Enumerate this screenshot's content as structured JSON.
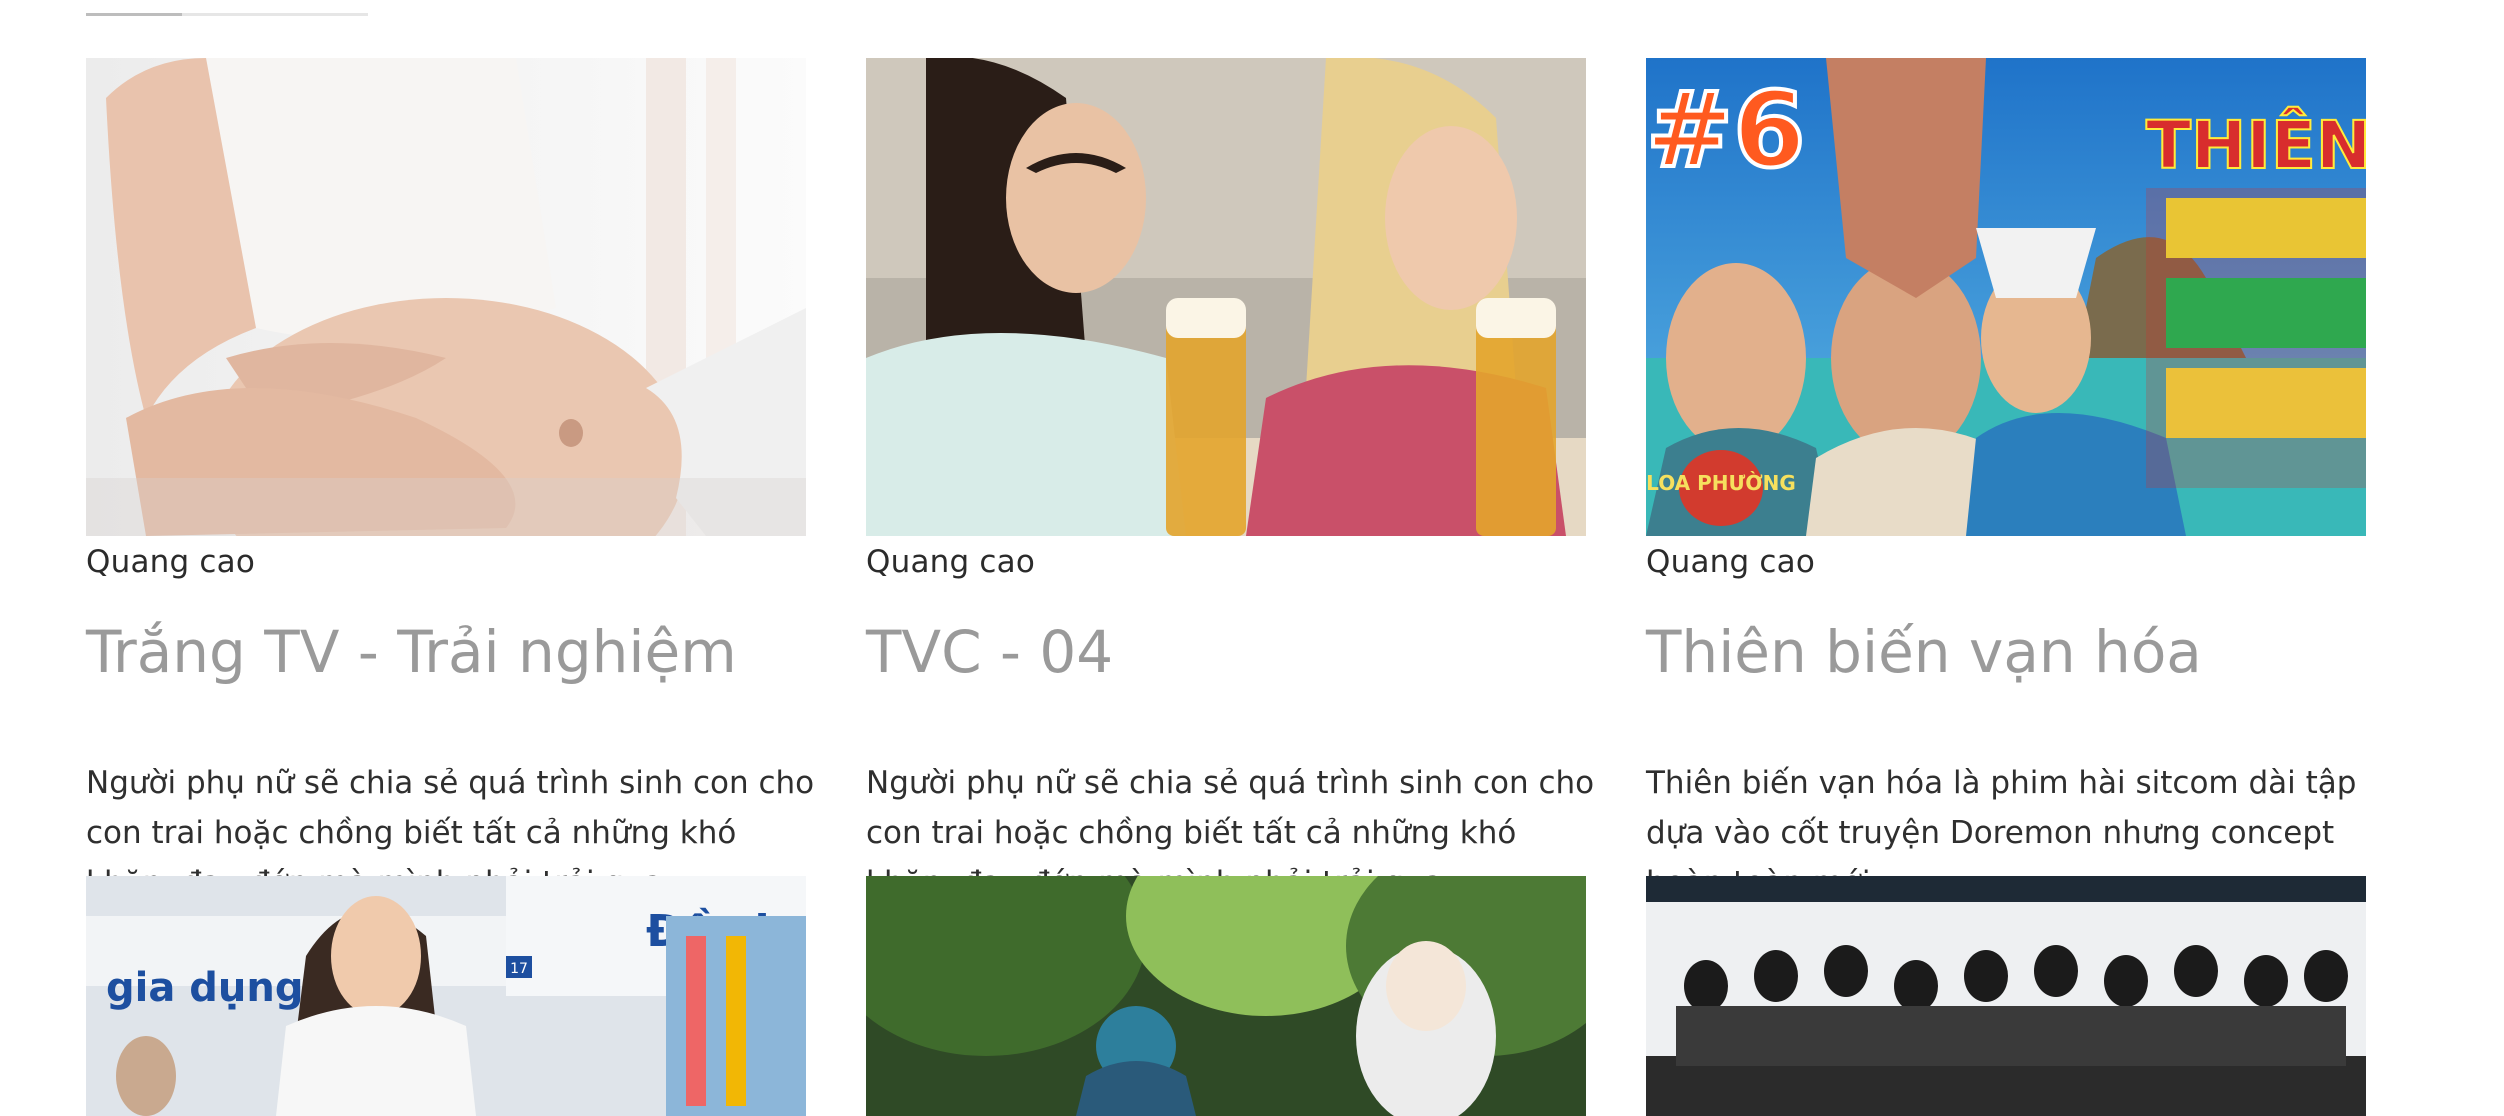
{
  "slider": {
    "progress": 0.34
  },
  "cards": [
    {
      "category": "Quang cao",
      "title": "Trắng TV - Trải nghiệm",
      "description": "Người phụ nữ sẽ chia sẻ quá trình sinh con cho con trai hoặc chồng biết tất cả những khó khăn, đau đớn mà mình phải trải qua",
      "thumbnail_icon": "pregnant-belly-photo"
    },
    {
      "category": "Quang cao",
      "title": "TVC - 04",
      "description": "Người phụ nữ sẽ chia sẻ quá trình sinh con cho con trai hoặc chồng biết tất cả những khó khăn, đau đớn mà mình phải trải qua",
      "thumbnail_icon": "women-beer-photo"
    },
    {
      "category": "Quang cao",
      "title": "Thiên biến vạn hóa",
      "description": "Thiên biến vạn hóa là phim hài sitcom dài tập dựa vào cốt truyện Doremon nhưng concept hoàn toàn mới.",
      "thumbnail_icon": "sitcom-poster-photo",
      "thumbnail_text": {
        "episode": "#6",
        "logo": "LOA PHƯỜNG",
        "poster": "THIÊN BIẾN VẠN HOÁ"
      }
    }
  ],
  "next_row": [
    {
      "thumbnail_icon": "supermarket-photo",
      "sign_text": "Đồ ch",
      "sign_text_2": "gia dụng",
      "sign_number": "17"
    },
    {
      "thumbnail_icon": "forest-old-man-photo"
    },
    {
      "thumbnail_icon": "group-photo"
    }
  ],
  "colors": {
    "title": "#9a9a9a",
    "text": "#2f2f2f",
    "background": "#ffffff"
  }
}
